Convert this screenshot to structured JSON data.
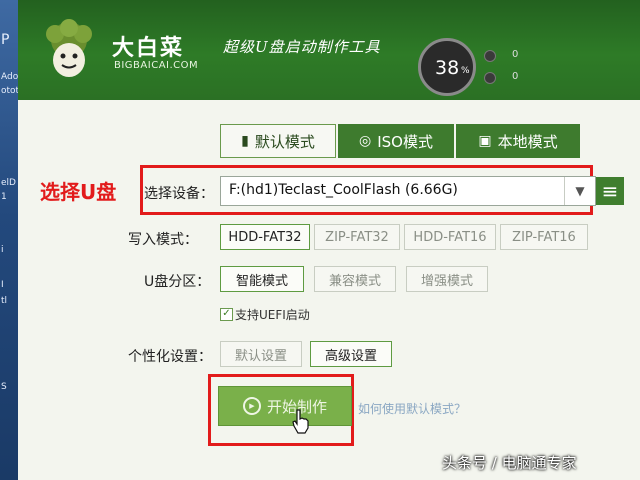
{
  "desktop": {
    "fragments": [
      "P",
      "Ado",
      "otot",
      "elD",
      "1",
      "i",
      "I",
      "tl",
      "S"
    ]
  },
  "app": {
    "brand_cn": "大白菜",
    "brand_en": "BIGBAICAI.COM",
    "slogan": "超级U盘启动制作工具",
    "gauge": {
      "value": "38",
      "unit": "%"
    },
    "stats": [
      "0",
      "0"
    ]
  },
  "tabs": [
    {
      "label": "默认模式",
      "icon": "usb-icon",
      "active": true
    },
    {
      "label": "ISO模式",
      "icon": "disc-icon",
      "active": false
    },
    {
      "label": "本地模式",
      "icon": "monitor-icon",
      "active": false
    }
  ],
  "annotation": "选择U盘",
  "device": {
    "label": "选择设备：",
    "value": "F:(hd1)Teclast_CoolFlash (6.66G)"
  },
  "write_mode": {
    "label": "写入模式：",
    "options": [
      "HDD-FAT32",
      "ZIP-FAT32",
      "HDD-FAT16",
      "ZIP-FAT16"
    ],
    "selected": "HDD-FAT32"
  },
  "partition": {
    "label": "U盘分区：",
    "options": [
      "智能模式",
      "兼容模式",
      "增强模式"
    ],
    "selected": "智能模式"
  },
  "uefi": {
    "label": "支持UEFI启动",
    "checked": true
  },
  "personalize": {
    "label": "个性化设置：",
    "options": [
      "默认设置",
      "高级设置"
    ]
  },
  "start_button": "开始制作",
  "help_link": "如何使用默认模式？",
  "watermark": "头条号 / 电脑通专家",
  "colors": {
    "header_green": "#2e7b27",
    "accent_green": "#3f7e2e",
    "annotation_red": "#e21b1b",
    "start_green": "#7ab04a"
  }
}
